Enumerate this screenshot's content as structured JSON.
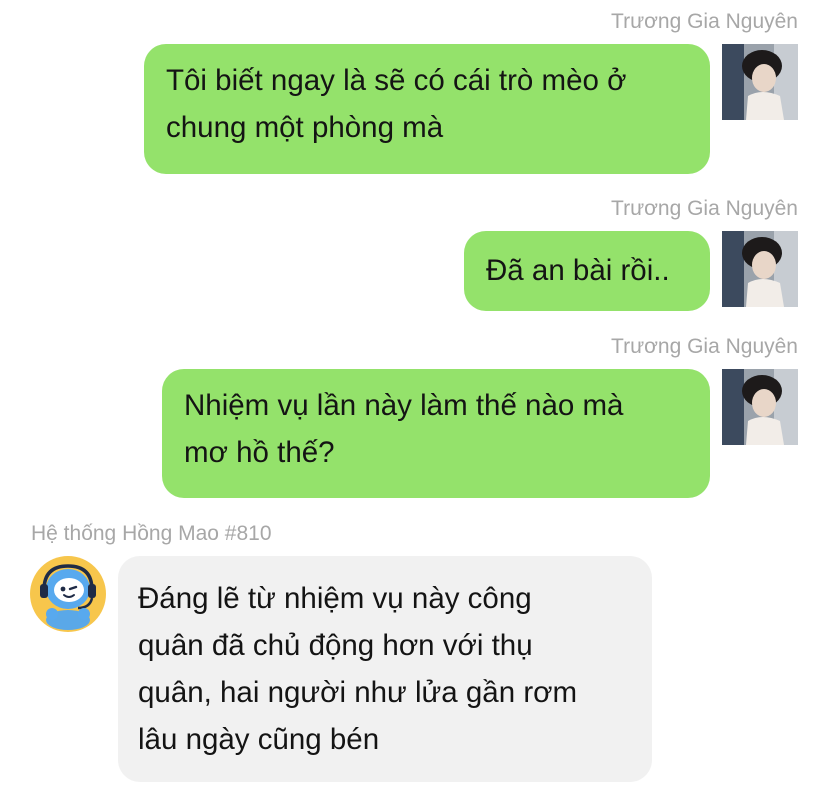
{
  "messages": [
    {
      "sender": "Trương Gia Nguyên",
      "lines": [
        "Tôi biết ngay là sẽ có cái trò mèo ở",
        "chung một phòng mà"
      ]
    },
    {
      "sender": "Trương Gia Nguyên",
      "lines": [
        "Đã an bài rồi.."
      ]
    },
    {
      "sender": "Trương Gia Nguyên",
      "lines": [
        "Nhiệm vụ lần này làm thế nào mà",
        "mơ hồ thế?"
      ]
    },
    {
      "sender": "Hệ thống Hồng Mao #810",
      "lines": [
        "Đáng lẽ từ nhiệm vụ này công",
        "quân đã chủ động hơn với thụ",
        "quân, hai người như lửa gần rơm",
        "lâu ngày cũng bén"
      ]
    }
  ],
  "icons": {
    "user_avatar": "user-photo-avatar",
    "bot_avatar": "robot-headset-avatar"
  },
  "colors": {
    "outgoing_bubble": "#94e26b",
    "incoming_bubble": "#f1f1f1",
    "sender_name": "#a7a7a7"
  }
}
